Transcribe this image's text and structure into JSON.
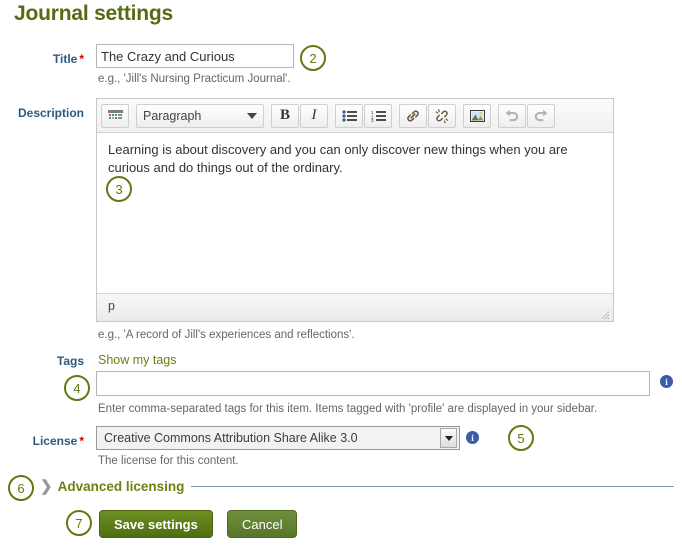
{
  "page": {
    "title": "Journal settings"
  },
  "fields": {
    "title": {
      "label": "Title",
      "required_mark": "*",
      "value": "The Crazy and Curious",
      "placeholder": "",
      "help": "e.g., 'Jill's Nursing Practicum Journal'."
    },
    "description": {
      "label": "Description",
      "content": "Learning is about discovery and you can only discover new things when you are curious and do things out of the ordinary.",
      "status_path": "p",
      "help": "e.g., 'A record of Jill's experiences and reflections'."
    },
    "tags": {
      "label": "Tags",
      "show_my_tags_link": "Show my tags",
      "value": "",
      "placeholder": "",
      "help": "Enter comma-separated tags for this item. Items tagged with 'profile' are displayed in your sidebar.",
      "info_icon": "info-icon"
    },
    "license": {
      "label": "License",
      "required_mark": "*",
      "selected": "Creative Commons Attribution Share Alike 3.0",
      "help": "The license for this content.",
      "info_icon": "info-icon"
    },
    "advanced_licensing": {
      "label": "Advanced licensing",
      "chevron_icon": "chevron-right-icon"
    }
  },
  "toolbar": {
    "format_block": "Paragraph",
    "buttons": [
      {
        "name": "table-grid-icon",
        "glyph": "grid",
        "disabled": false
      },
      {
        "name": "bold-icon",
        "glyph": "B",
        "disabled": false
      },
      {
        "name": "italic-icon",
        "glyph": "I",
        "disabled": false
      },
      {
        "name": "bulleted-list-icon",
        "glyph": "ul",
        "disabled": false
      },
      {
        "name": "numbered-list-icon",
        "glyph": "ol",
        "disabled": false
      },
      {
        "name": "link-icon",
        "glyph": "link",
        "disabled": false
      },
      {
        "name": "unlink-icon",
        "glyph": "unlink",
        "disabled": false
      },
      {
        "name": "image-icon",
        "glyph": "image",
        "disabled": false
      },
      {
        "name": "undo-icon",
        "glyph": "undo",
        "disabled": true
      },
      {
        "name": "redo-icon",
        "glyph": "redo",
        "disabled": true
      }
    ]
  },
  "actions": {
    "save_label": "Save settings",
    "cancel_label": "Cancel"
  },
  "callouts": [
    {
      "number": "2",
      "target": "title-field"
    },
    {
      "number": "3",
      "target": "description-editor"
    },
    {
      "number": "4",
      "target": "tags-field"
    },
    {
      "number": "5",
      "target": "license-field"
    },
    {
      "number": "6",
      "target": "advanced-licensing"
    },
    {
      "number": "7",
      "target": "save-button"
    }
  ],
  "colors": {
    "heading_green": "#556b11",
    "callout_green": "#5f7a14",
    "label_blue": "#2e5a7d",
    "required_red": "#cc0000",
    "button_green": "#4e6d12",
    "info_blue": "#3b5ca8"
  }
}
